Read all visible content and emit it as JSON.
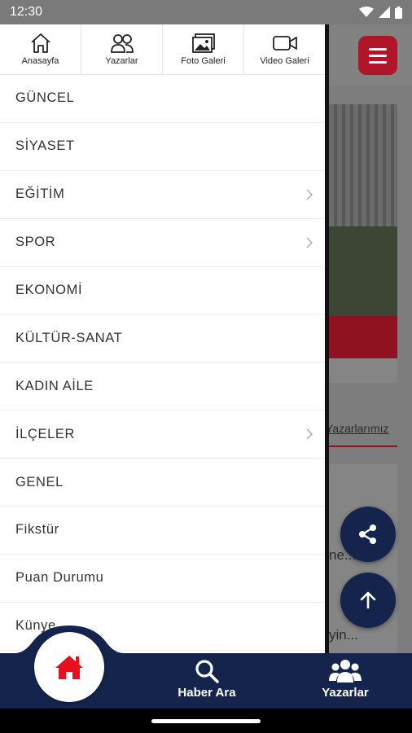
{
  "status_bar": {
    "time": "12:30"
  },
  "quick_nav": [
    {
      "label": "Anasayfa",
      "icon": "home-outline-icon"
    },
    {
      "label": "Yazarlar",
      "icon": "people-outline-icon"
    },
    {
      "label": "Foto Galeri",
      "icon": "photo-gallery-icon"
    },
    {
      "label": "Video Galeri",
      "icon": "video-camera-icon"
    }
  ],
  "menu": [
    {
      "label": "GÜNCEL",
      "has_submenu": false
    },
    {
      "label": "SİYASET",
      "has_submenu": false
    },
    {
      "label": "EĞİTİM",
      "has_submenu": true
    },
    {
      "label": "SPOR",
      "has_submenu": true
    },
    {
      "label": "EKONOMİ",
      "has_submenu": false
    },
    {
      "label": "KÜLTÜR-SANAT",
      "has_submenu": false
    },
    {
      "label": "KADIN AİLE",
      "has_submenu": false
    },
    {
      "label": "İLÇELER",
      "has_submenu": true
    },
    {
      "label": "GENEL",
      "has_submenu": false
    },
    {
      "label": "Fikstür",
      "has_submenu": false
    },
    {
      "label": "Puan Durumu",
      "has_submenu": false
    },
    {
      "label": "Künye",
      "has_submenu": false
    }
  ],
  "background": {
    "tab_label": "Yazarlarımız",
    "snippet_1": "ne...",
    "snippet_2": "yin..."
  },
  "bottom_nav": {
    "search_label": "Haber Ara",
    "writers_label": "Yazarlar"
  },
  "colors": {
    "navy": "#14244d",
    "brand_red": "#c8102e",
    "home_icon_red": "#e8101e"
  }
}
